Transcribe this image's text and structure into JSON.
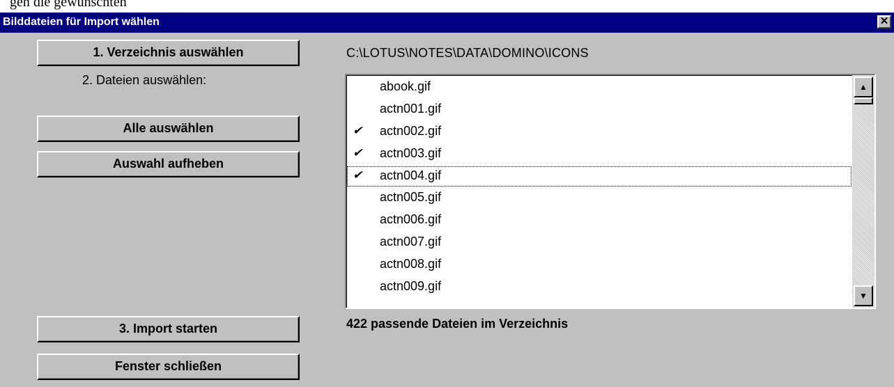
{
  "background_caption": "gen die gewünschten",
  "window": {
    "title": "Bilddateien für Import wählen",
    "close_glyph": "✕",
    "close_icon": "close-icon"
  },
  "buttons": {
    "select_directory": "1. Verzeichnis auswählen",
    "select_all": "Alle auswählen",
    "deselect": "Auswahl aufheben",
    "start_import": "3. Import starten",
    "close_window": "Fenster schließen"
  },
  "labels": {
    "select_files": "2. Dateien auswählen:"
  },
  "directory_path": "C:\\LOTUS\\NOTES\\DATA\\DOMINO\\ICONS",
  "file_list": {
    "items": [
      {
        "name": "abook.gif",
        "checked": false,
        "focused": false
      },
      {
        "name": "actn001.gif",
        "checked": false,
        "focused": false
      },
      {
        "name": "actn002.gif",
        "checked": true,
        "focused": false
      },
      {
        "name": "actn003.gif",
        "checked": true,
        "focused": false
      },
      {
        "name": "actn004.gif",
        "checked": true,
        "focused": true
      },
      {
        "name": "actn005.gif",
        "checked": false,
        "focused": false
      },
      {
        "name": "actn006.gif",
        "checked": false,
        "focused": false
      },
      {
        "name": "actn007.gif",
        "checked": false,
        "focused": false
      },
      {
        "name": "actn008.gif",
        "checked": false,
        "focused": false
      },
      {
        "name": "actn009.gif",
        "checked": false,
        "focused": false
      }
    ],
    "check_glyph": "✔",
    "scroll_up_glyph": "▲",
    "scroll_down_glyph": "▼"
  },
  "status": {
    "match_count": "422 passende Dateien im Verzeichnis"
  },
  "colors": {
    "titlebar": "#000080",
    "dialog_bg": "#c0c0c0"
  }
}
